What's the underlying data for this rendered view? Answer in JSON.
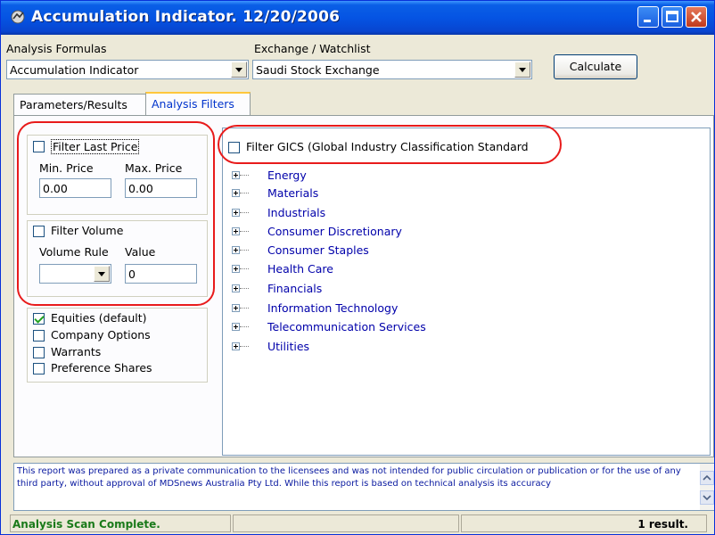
{
  "window": {
    "title": "Accumulation Indicator. 12/20/2006"
  },
  "form": {
    "analysis_formulas_label": "Analysis Formulas",
    "analysis_formula_value": "Accumulation Indicator",
    "exchange_label": "Exchange / Watchlist",
    "exchange_value": "Saudi Stock Exchange",
    "calculate_label": "Calculate"
  },
  "tabs": [
    {
      "label": "Parameters/Results",
      "active": false
    },
    {
      "label": "Analysis Filters",
      "active": true
    }
  ],
  "filters": {
    "last_price": {
      "label": "Filter Last Price",
      "checked": false,
      "min_label": "Min. Price",
      "min_value": "0.00",
      "max_label": "Max. Price",
      "max_value": "0.00"
    },
    "volume": {
      "label": "Filter Volume",
      "checked": false,
      "rule_label": "Volume Rule",
      "value_label": "Value",
      "value": "0"
    },
    "security_types": [
      {
        "label": "Equities (default)",
        "checked": true
      },
      {
        "label": "Company Options",
        "checked": false
      },
      {
        "label": "Warrants",
        "checked": false
      },
      {
        "label": "Preference Shares",
        "checked": false
      }
    ],
    "gics": {
      "label": "Filter GICS (Global Industry Classification Standard",
      "checked": false,
      "sectors": [
        "Energy",
        "Materials",
        "Industrials",
        "Consumer Discretionary",
        "Consumer Staples",
        "Health Care",
        "Financials",
        "Information Technology",
        "Telecommunication Services",
        "Utilities"
      ]
    }
  },
  "report_text": "This report was prepared as a private communication to the licensees and was not intended for public circulation or publication or for the use of any third party, without approval of MDSnews Australia Pty Ltd. While this report is based on technical analysis its accuracy",
  "status": {
    "message": "Analysis Scan Complete.",
    "result": "1 result."
  },
  "colors": {
    "annotation": "#e81b1b",
    "titlebar": "#0554e3",
    "status_message": "#1a7a1a"
  }
}
